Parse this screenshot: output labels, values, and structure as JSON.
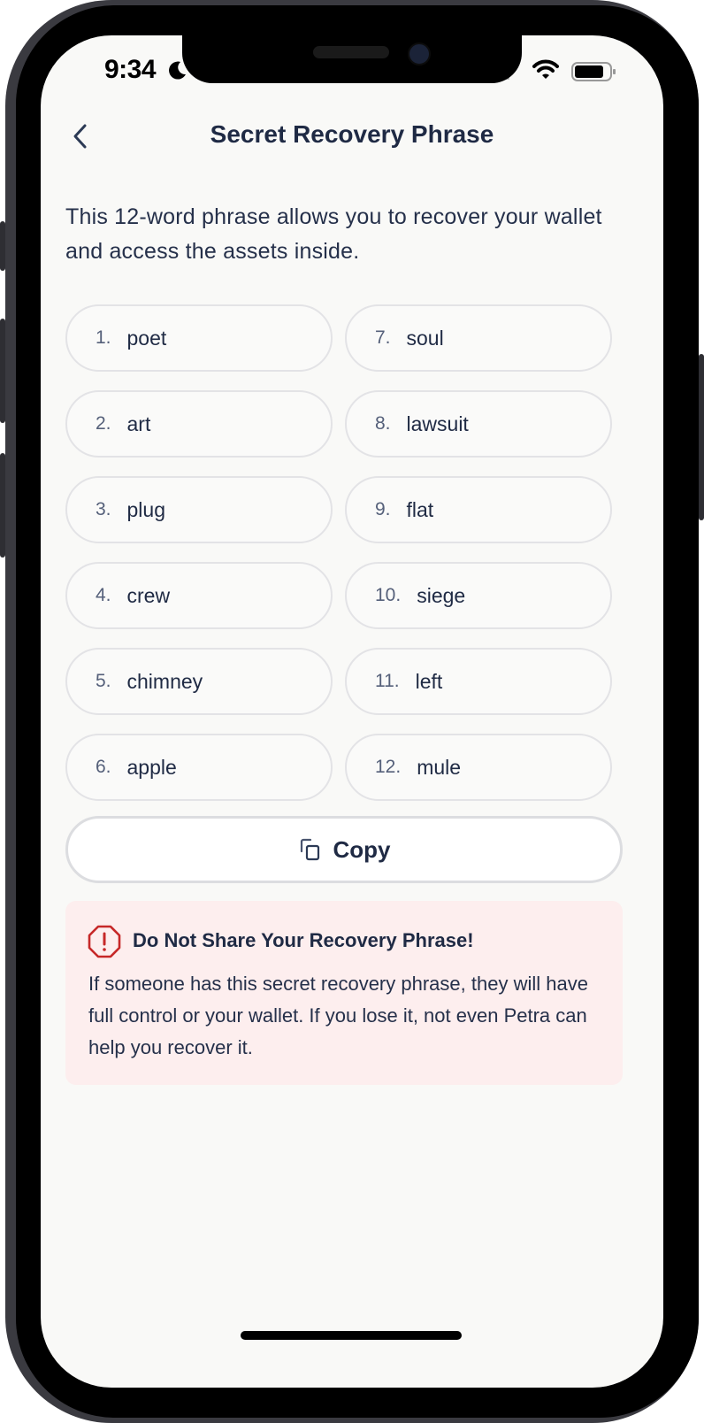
{
  "status_bar": {
    "time": "9:34"
  },
  "header": {
    "title": "Secret Recovery Phrase",
    "back_icon": "chevron-left-icon"
  },
  "intro": "This 12-word phrase allows you to recover your wallet and access the assets inside.",
  "words": [
    {
      "num": "1.",
      "word": "poet"
    },
    {
      "num": "7.",
      "word": "soul"
    },
    {
      "num": "2.",
      "word": "art"
    },
    {
      "num": "8.",
      "word": "lawsuit"
    },
    {
      "num": "3.",
      "word": "plug"
    },
    {
      "num": "9.",
      "word": "flat"
    },
    {
      "num": "4.",
      "word": "crew"
    },
    {
      "num": "10.",
      "word": "siege"
    },
    {
      "num": "5.",
      "word": "chimney"
    },
    {
      "num": "11.",
      "word": "left"
    },
    {
      "num": "6.",
      "word": "apple"
    },
    {
      "num": "12.",
      "word": "mule"
    }
  ],
  "copy_button": {
    "label": "Copy",
    "icon": "copy-icon"
  },
  "warning": {
    "icon": "alert-octagon-icon",
    "title": "Do Not Share Your Recovery Phrase!",
    "body": "If someone has this secret recovery phrase, they will have full control or your wallet. If you lose it, not even Petra can help you recover it.",
    "color": "#c62828",
    "background": "#fdeeee"
  },
  "colors": {
    "text_primary": "#1f2a44",
    "screen_bg": "#f9f9f7"
  }
}
